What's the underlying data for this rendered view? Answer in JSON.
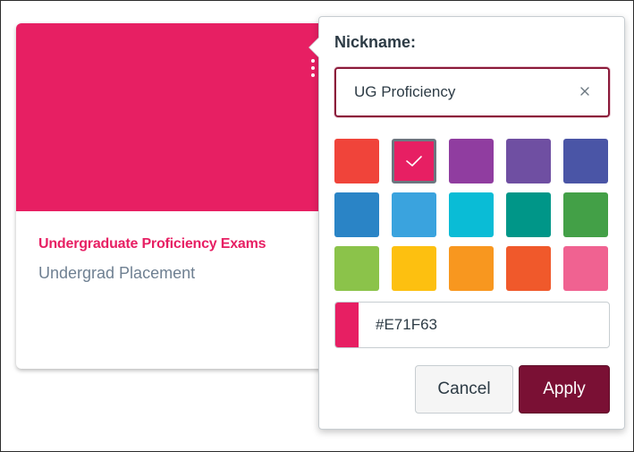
{
  "card": {
    "color": "#E71F63",
    "title": "Undergraduate Proficiency Exams",
    "subtitle": "Undergrad Placement"
  },
  "popover": {
    "nickname_label": "Nickname:",
    "nickname_value": "UG Proficiency",
    "hex_value": "#E71F63",
    "selected_color": "#E71F63",
    "swatches": [
      {
        "name": "red",
        "color": "#F0443A"
      },
      {
        "name": "pink",
        "color": "#E71F63",
        "selected": true
      },
      {
        "name": "purple",
        "color": "#903DA0"
      },
      {
        "name": "deep-purple",
        "color": "#6F4FA2"
      },
      {
        "name": "indigo",
        "color": "#4A55A6"
      },
      {
        "name": "blue",
        "color": "#2A84C6"
      },
      {
        "name": "light-blue",
        "color": "#3AA3DE"
      },
      {
        "name": "cyan",
        "color": "#0ABCD6"
      },
      {
        "name": "teal",
        "color": "#009688"
      },
      {
        "name": "green",
        "color": "#43A047"
      },
      {
        "name": "light-green",
        "color": "#8BC34A"
      },
      {
        "name": "amber",
        "color": "#FDC010"
      },
      {
        "name": "orange",
        "color": "#F8971F"
      },
      {
        "name": "deep-orange",
        "color": "#F0592B"
      },
      {
        "name": "light-pink",
        "color": "#F06291"
      }
    ],
    "cancel_label": "Cancel",
    "apply_label": "Apply",
    "apply_color": "#7A1034"
  }
}
